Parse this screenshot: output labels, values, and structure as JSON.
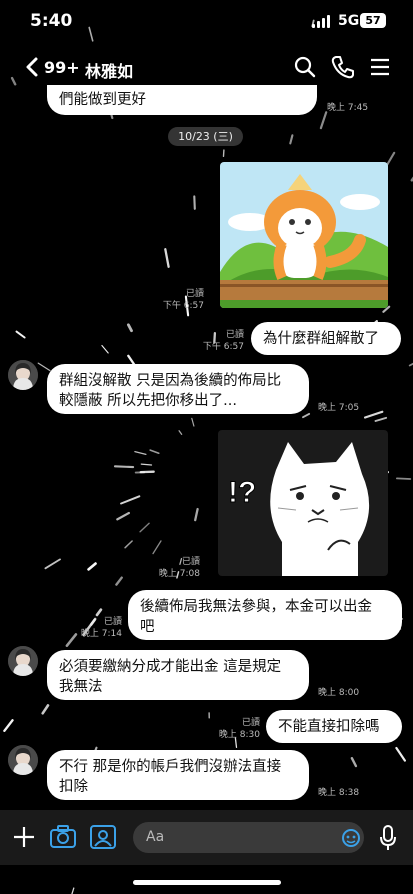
{
  "status": {
    "time": "5:40",
    "network": "5G",
    "battery": "57"
  },
  "header": {
    "unread": "99+",
    "title": "林雅如"
  },
  "messages": {
    "m1": {
      "text": "們能做到更好",
      "time": "晚上 7:45"
    },
    "date": "10/23 (三)",
    "m2": {
      "read": "已讀",
      "time": "下午 6:57"
    },
    "m3": {
      "text": "為什麼群組解散了",
      "read": "已讀",
      "time": "下午 6:57"
    },
    "m4": {
      "line1": "群組沒解散  只是因為後續的佈局比",
      "line2": "較隱蔽  所以先把你移出了...",
      "time": "晚上 7:05"
    },
    "m5": {
      "read": "已讀",
      "time": "晚上 7:08"
    },
    "m6": {
      "line1": "後續佈局我無法參與，本金可以出金",
      "line2": "吧",
      "read": "已讀",
      "time": "晚上 7:14"
    },
    "m7": {
      "line1": "必須要繳納分成才能出金  這是規定",
      "line2": "我無法",
      "time": "晚上 8:00"
    },
    "m8": {
      "text": "不能直接扣除嗎",
      "read": "已讀",
      "time": "晚上 8:30"
    },
    "m9": {
      "line1": "不行  那是你的帳戶我們沒辦法直接",
      "line2": "扣除",
      "time": "晚上 8:38"
    }
  },
  "input": {
    "placeholder": "Aa"
  },
  "colors": {
    "bubble": "#ffffff",
    "background": "#000000"
  }
}
